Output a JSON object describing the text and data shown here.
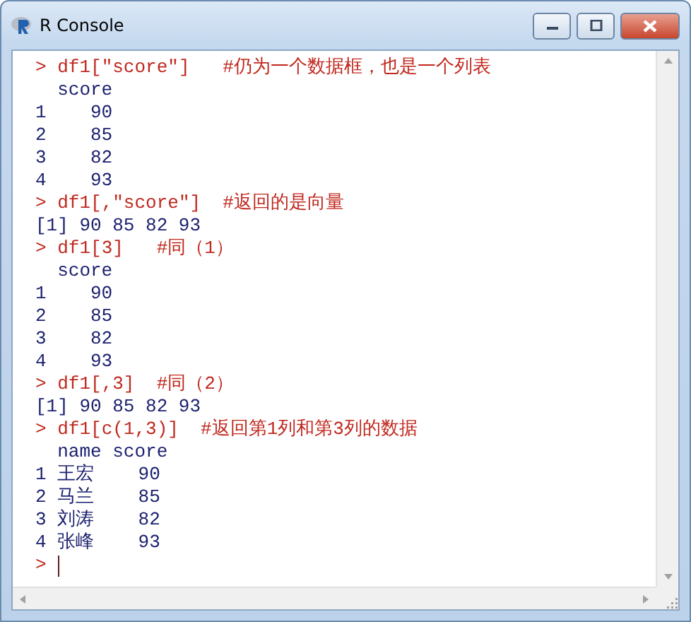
{
  "window": {
    "title": "R Console"
  },
  "lines": [
    {
      "kind": "input",
      "prompt": ">",
      "code": "df1[\"score\"]   ",
      "comment": "#仍为一个数据框，也是一个列表"
    },
    {
      "kind": "output",
      "text": "  score"
    },
    {
      "kind": "output",
      "text": "1    90"
    },
    {
      "kind": "output",
      "text": "2    85"
    },
    {
      "kind": "output",
      "text": "3    82"
    },
    {
      "kind": "output",
      "text": "4    93"
    },
    {
      "kind": "input",
      "prompt": ">",
      "code": "df1[,\"score\"]  ",
      "comment": "#返回的是向量"
    },
    {
      "kind": "output",
      "text": "[1] 90 85 82 93"
    },
    {
      "kind": "input",
      "prompt": ">",
      "code": "df1[3]   ",
      "comment": "#同（1）"
    },
    {
      "kind": "output",
      "text": "  score"
    },
    {
      "kind": "output",
      "text": "1    90"
    },
    {
      "kind": "output",
      "text": "2    85"
    },
    {
      "kind": "output",
      "text": "3    82"
    },
    {
      "kind": "output",
      "text": "4    93"
    },
    {
      "kind": "input",
      "prompt": ">",
      "code": "df1[,3]  ",
      "comment": "#同（2）"
    },
    {
      "kind": "output",
      "text": "[1] 90 85 82 93"
    },
    {
      "kind": "input",
      "prompt": ">",
      "code": "df1[c(1,3)]  ",
      "comment": "#返回第1列和第3列的数据"
    },
    {
      "kind": "output",
      "text": "  name score"
    },
    {
      "kind": "output",
      "text": "1 王宏    90"
    },
    {
      "kind": "output",
      "text": "2 马兰    85"
    },
    {
      "kind": "output",
      "text": "3 刘涛    82"
    },
    {
      "kind": "output",
      "text": "4 张峰    93"
    },
    {
      "kind": "prompt",
      "prompt": ">"
    }
  ]
}
